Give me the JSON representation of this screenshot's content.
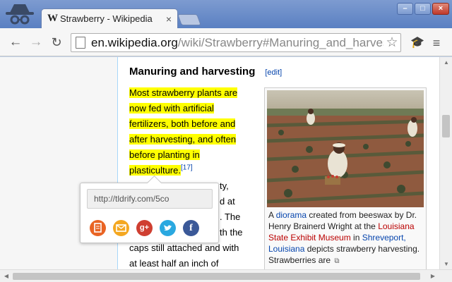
{
  "window": {
    "min_glyph": "–",
    "max_glyph": "□",
    "close_glyph": "×"
  },
  "tab": {
    "favicon": "W",
    "title": "Strawberry - Wikipedia",
    "close_glyph": "×"
  },
  "toolbar": {
    "back_glyph": "←",
    "forward_glyph": "→",
    "reload_glyph": "↻",
    "url_host": "en.wikipedia.org",
    "url_path": "/wiki/Strawberry#Manuring_and_harvesting",
    "star_glyph": "☆",
    "extension_glyph": "🎓",
    "menu_glyph": "≡"
  },
  "article": {
    "heading": "Manuring and harvesting",
    "edit_link": "[edit]",
    "highlighted_text": "Most strawberry plants are now fed with artificial fertilizers, both before and after harvesting, and often before planting in plasticulture.",
    "ref": "[17]",
    "lines": [
      "ty,",
      "d at",
      ". The",
      "th the",
      "caps still attached and with",
      "at least half an inch of"
    ]
  },
  "figure": {
    "caption_prefix": "A ",
    "caption_link1": "diorama",
    "caption_text1": " created from beeswax by Dr. Henry Brainerd Wright at the ",
    "caption_redlink": "Louisiana State Exhibit Museum",
    "caption_text2": " in ",
    "caption_link2": "Shreveport, Louisiana",
    "caption_text3": " depicts strawberry harvesting. Strawberries are",
    "magnify_glyph": "⧉"
  },
  "share_popup": {
    "short_url": "http://tldrify.com/5co",
    "icons": [
      "document-icon",
      "email-icon",
      "google-plus-icon",
      "twitter-icon",
      "facebook-icon"
    ],
    "gplus_label": "g+",
    "fb_label": "f"
  },
  "colors": {
    "highlight": "#ffff00",
    "link": "#0645ad",
    "redlink": "#ba0000"
  }
}
